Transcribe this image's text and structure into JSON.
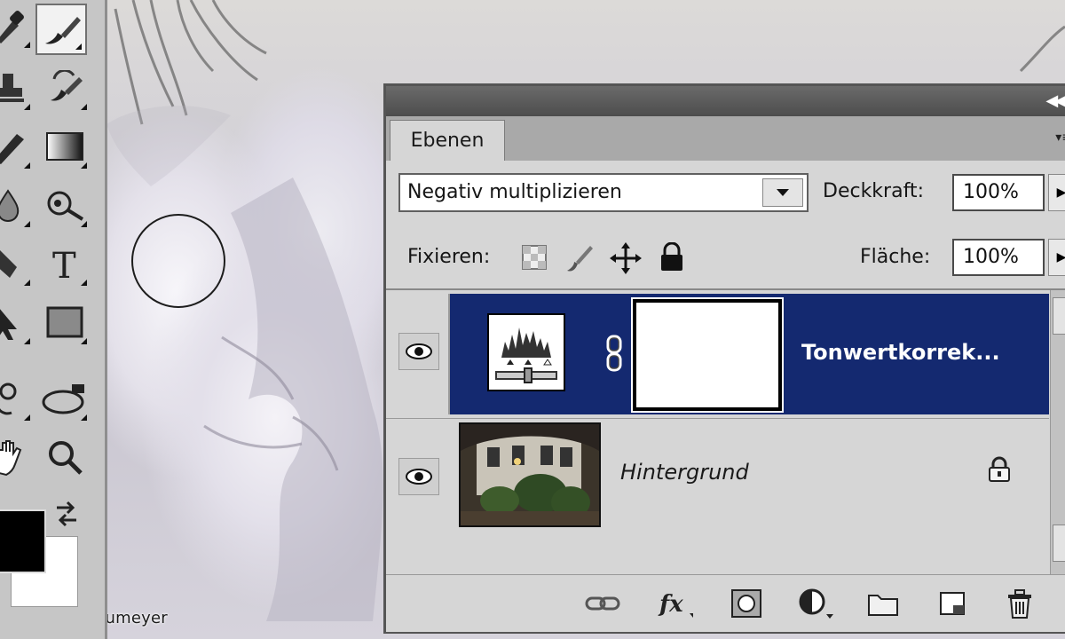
{
  "watermark": "© Heico Neumeyer",
  "layers_panel": {
    "tab": "Ebenen",
    "blend_mode": "Negativ multiplizieren",
    "opacity_label": "Deckkraft:",
    "opacity_value": "100%",
    "lock_label": "Fixieren:",
    "fill_label": "Fläche:",
    "fill_value": "100%",
    "layers": [
      {
        "name": "Tonwertkorrek...",
        "type": "adjustment",
        "selected": true,
        "visible": true
      },
      {
        "name": "Hintergrund",
        "type": "image",
        "selected": false,
        "visible": true,
        "locked": true
      }
    ]
  },
  "colors": {
    "selection": "#142970",
    "panel_bg": "#d6d6d6",
    "titlebar": "#4d4d4d"
  },
  "icons": [
    "eyedropper-icon",
    "brush-icon",
    "stamp-icon",
    "history-brush-icon",
    "eraser-icon",
    "gradient-icon",
    "blur-icon",
    "dodge-icon",
    "pen-icon",
    "type-icon",
    "path-select-icon",
    "rectangle-icon",
    "3d-rotate-icon",
    "3d-orbit-icon",
    "hand-icon",
    "zoom-icon",
    "swap-colors-icon",
    "link-icon",
    "fx-icon",
    "add-mask-icon",
    "adjustment-layer-icon",
    "folder-icon",
    "new-layer-icon",
    "trash-icon",
    "eye-icon",
    "lock-icon"
  ]
}
